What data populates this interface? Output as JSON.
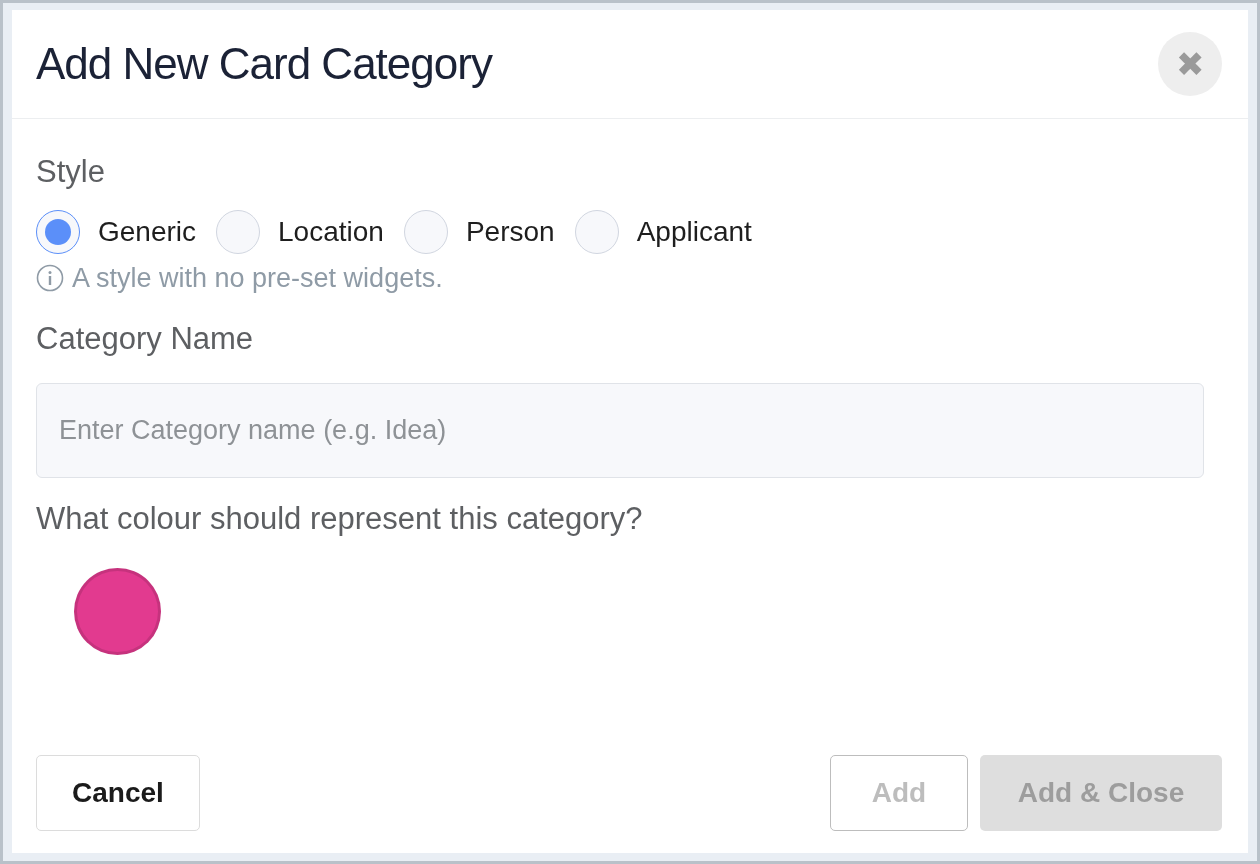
{
  "dialog": {
    "title": "Add New Card Category",
    "close_label": "✖"
  },
  "style": {
    "label": "Style",
    "options": [
      {
        "label": "Generic",
        "selected": true
      },
      {
        "label": "Location",
        "selected": false
      },
      {
        "label": "Person",
        "selected": false
      },
      {
        "label": "Applicant",
        "selected": false
      }
    ],
    "hint": "A style with no pre-set widgets."
  },
  "category_name": {
    "label": "Category Name",
    "placeholder": "Enter Category name (e.g. Idea)"
  },
  "colour": {
    "label": "What colour should represent this category?",
    "swatches": [
      {
        "color": "#e23a8f"
      }
    ]
  },
  "footer": {
    "buttons": [
      {
        "label": "Cancel",
        "kind": "secondary",
        "disabled": false
      },
      {
        "label": "Add",
        "kind": "outline",
        "disabled": true
      },
      {
        "label": "Add & Close",
        "kind": "filled",
        "disabled": true
      }
    ]
  }
}
